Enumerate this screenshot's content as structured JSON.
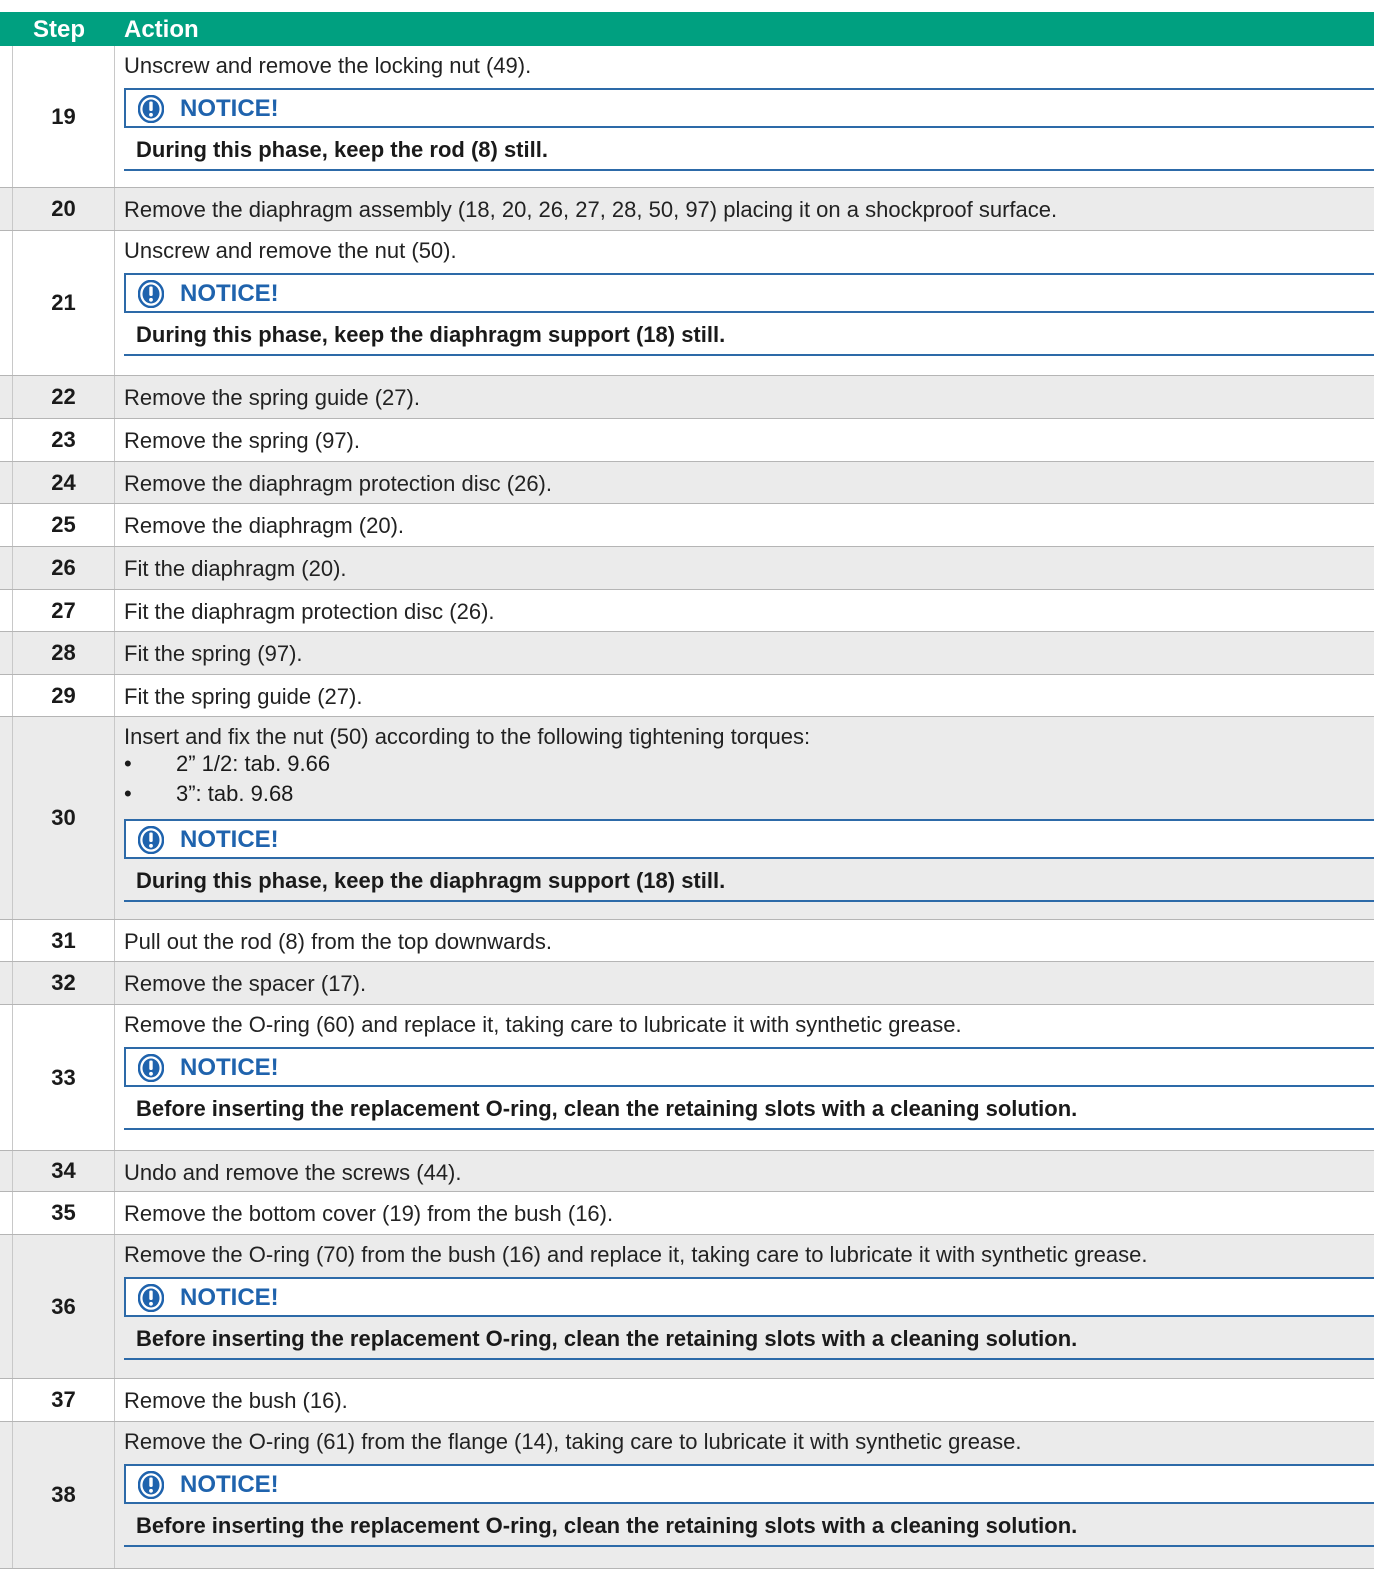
{
  "header": {
    "step": "Step",
    "action": "Action"
  },
  "notice_label": "NOTICE!",
  "accent_color": "#00a080",
  "notice_color": "#1f63ad",
  "icons": {
    "notice": "exclamation-icon"
  },
  "rows": [
    {
      "step": "19",
      "text": "Unscrew and remove the locking nut (49).",
      "notice": "During this phase, keep the rod (8) still."
    },
    {
      "step": "20",
      "text": "Remove the diaphragm assembly (18, 20, 26, 27, 28, 50, 97) placing it on a shockproof surface."
    },
    {
      "step": "21",
      "text": "Unscrew and remove the nut (50).",
      "notice": "During this phase, keep the diaphragm support (18) still."
    },
    {
      "step": "22",
      "text": "Remove the spring guide (27)."
    },
    {
      "step": "23",
      "text": "Remove the spring (97)."
    },
    {
      "step": "24",
      "text": "Remove the diaphragm protection disc (26)."
    },
    {
      "step": "25",
      "text": "Remove the diaphragm (20)."
    },
    {
      "step": "26",
      "text": "Fit the diaphragm (20)."
    },
    {
      "step": "27",
      "text": "Fit the diaphragm protection disc (26)."
    },
    {
      "step": "28",
      "text": "Fit the spring (97)."
    },
    {
      "step": "29",
      "text": "Fit the spring guide (27)."
    },
    {
      "step": "30",
      "text": "Insert and fix the nut (50) according to the following tightening torques:",
      "bullets": [
        "2” 1/2: tab. 9.66",
        "3”: tab. 9.68"
      ],
      "notice": "During this phase, keep the diaphragm support (18) still."
    },
    {
      "step": "31",
      "text": "Pull out the rod (8) from the top downwards."
    },
    {
      "step": "32",
      "text": "Remove the spacer (17)."
    },
    {
      "step": "33",
      "text": "Remove the O-ring (60) and replace it, taking care to lubricate it with synthetic grease.",
      "notice": "Before inserting the replacement O-ring, clean the retaining slots with a cleaning solution."
    },
    {
      "step": "34",
      "text": "Undo and remove the screws (44)."
    },
    {
      "step": "35",
      "text": "Remove the bottom cover (19) from the bush (16)."
    },
    {
      "step": "36",
      "text": "Remove the O-ring (70) from the bush (16) and replace it, taking care to lubricate it with synthetic grease.",
      "notice": "Before inserting the replacement O-ring, clean the retaining slots with a cleaning solution."
    },
    {
      "step": "37",
      "text": "Remove the bush (16)."
    },
    {
      "step": "38",
      "text": "Remove the O-ring (61) from the flange (14), taking care to lubricate it with synthetic grease.",
      "notice": "Before inserting the replacement O-ring, clean the retaining slots with a cleaning solution."
    }
  ]
}
